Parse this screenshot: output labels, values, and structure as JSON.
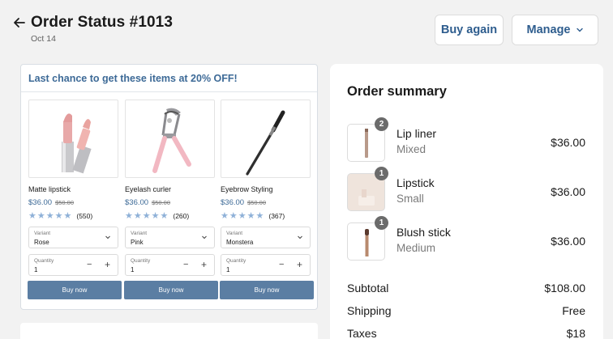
{
  "header": {
    "title": "Order Status #1013",
    "date": "Oct 14",
    "buy_again_label": "Buy again",
    "manage_label": "Manage"
  },
  "promo": {
    "title": "Last chance to get these items at 20% OFF!",
    "products": [
      {
        "name": "Matte lipstick",
        "price": "$36.00",
        "old_price": "$50.00",
        "rating": 5,
        "review_count": "(550)",
        "variant_label": "Variant",
        "variant_value": "Rose",
        "quantity_label": "Quantity",
        "quantity_value": "1",
        "buy_label": "Buy now",
        "icon": "lipstick-image"
      },
      {
        "name": "Eyelash curler",
        "price": "$36.00",
        "old_price": "$50.00",
        "rating": 5,
        "review_count": "(260)",
        "variant_label": "Variant",
        "variant_value": "Pink",
        "quantity_label": "Quantity",
        "quantity_value": "1",
        "buy_label": "Buy now",
        "icon": "eyelash-curler-image"
      },
      {
        "name": "Eyebrow Styling",
        "price": "$36.00",
        "old_price": "$50.00",
        "rating": 5,
        "review_count": "(367)",
        "variant_label": "Variant",
        "variant_value": "Monstera",
        "quantity_label": "Quantity",
        "quantity_value": "1",
        "buy_label": "Buy now",
        "icon": "brow-brush-image"
      }
    ]
  },
  "summary": {
    "title": "Order summary",
    "items": [
      {
        "name": "Lip liner",
        "variant": "Mixed",
        "price": "$36.00",
        "quantity": "2"
      },
      {
        "name": "Lipstick",
        "variant": "Small",
        "price": "$36.00",
        "quantity": "1"
      },
      {
        "name": "Blush stick",
        "variant": "Medium",
        "price": "$36.00",
        "quantity": "1"
      }
    ],
    "subtotal_label": "Subtotal",
    "subtotal_value": "$108.00",
    "shipping_label": "Shipping",
    "shipping_value": "Free",
    "taxes_label": "Taxes",
    "taxes_value": "$18"
  },
  "colors": {
    "accent": "#3d6a97",
    "button_fill": "#5b7ea3",
    "star": "#8fb1d8",
    "background": "#f2f2f2"
  }
}
